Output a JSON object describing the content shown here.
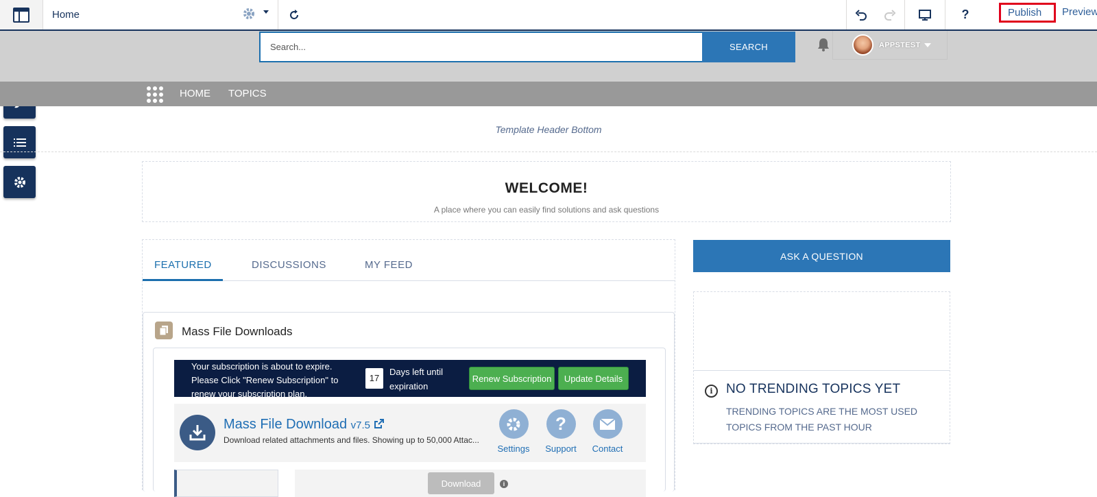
{
  "topbar": {
    "page_name": "Home",
    "publish_label": "Publish",
    "preview_label": "Preview"
  },
  "left_tools": [
    "lightning-icon",
    "brush-icon",
    "list-icon",
    "gear-icon"
  ],
  "header": {
    "search_placeholder": "Search...",
    "search_button": "SEARCH",
    "username": "APPSTEST"
  },
  "nav": {
    "items": [
      "HOME",
      "TOPICS"
    ]
  },
  "template_header_bottom": "Template Header Bottom",
  "welcome": {
    "title": "WELCOME!",
    "subtitle": "A place where you can easily find solutions and ask questions"
  },
  "tabs": [
    {
      "label": "FEATURED",
      "active": true
    },
    {
      "label": "DISCUSSIONS",
      "active": false
    },
    {
      "label": "MY FEED",
      "active": false
    }
  ],
  "mfd": {
    "card_title": "Mass File Downloads",
    "subscription_message": "Your subscription is about to expire. Please Click \"Renew Subscription\" to renew your subscription plan.",
    "days_left": "17",
    "days_text": "Days left until expiration",
    "renew_button": "Renew Subscription",
    "update_button": "Update Details",
    "app_name": "Mass File Download",
    "app_version": "v7.5",
    "app_description": "Download related attachments and files. Showing up to 50,000 Attac...",
    "actions": [
      "Settings",
      "Support",
      "Contact"
    ],
    "download_button": "Download"
  },
  "right": {
    "ask_button": "ASK A QUESTION",
    "trending_title": "NO TRENDING TOPICS YET",
    "trending_desc": "TRENDING TOPICS ARE THE MOST USED TOPICS FROM THE PAST HOUR"
  },
  "colors": {
    "brand_navy": "#16325c",
    "accent_blue": "#2c76b6",
    "green": "#4caf50",
    "highlight_red": "#e0001b"
  }
}
